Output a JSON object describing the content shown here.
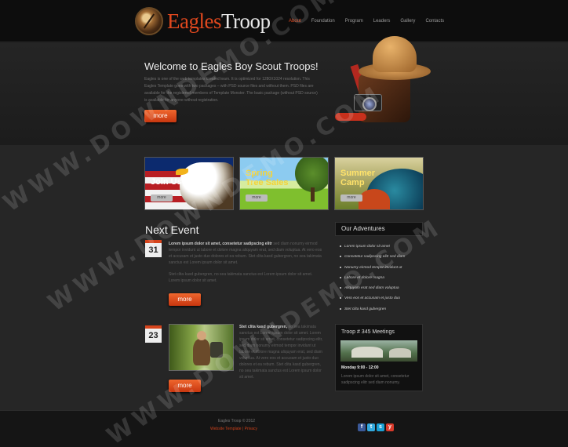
{
  "logo": {
    "word1": "Eagles",
    "word2": "Troop"
  },
  "nav": [
    "About",
    "Foundation",
    "Program",
    "Leaders",
    "Gallery",
    "Contacts"
  ],
  "hero": {
    "title": "Welcome to Eagles Boy Scout Troops!",
    "body": "Eagles is one of the web templates created team. It is optimized for 1280X1024 resolution. This Eagles Template goes with two packages – with PSD source files and without them. PSD files are available for the registered members of Template Monster. The basic package (without PSD source) is available for anyone without registration.",
    "button": "more"
  },
  "banners": [
    {
      "title": "Join Us",
      "button": "more"
    },
    {
      "title": "Spring Tree Sales",
      "button": "more"
    },
    {
      "title": "Summer Camp",
      "button": "more"
    }
  ],
  "next_event": {
    "heading": "Next Event",
    "events": [
      {
        "day": "31",
        "lead": "Lorem ipsum dolor sit amet, consetetur sadipscing elitr",
        "body": "sed diam nonumy eirmod tempor invidunt ut labore et dolore magna aliquyam erat, sed diam voluptua. At vero eos et accusam et justo duo dolores et ea rebum. Stet clita kasd gubergren, no sea takimata sanctus est Lorem ipsum dolor sit amet.",
        "body2": "Stet clita kasd gubergren, no sea takimata sanctus est Lorem ipsum dolor sit amet. Lorem ipsum dolor sit amet.",
        "button": "more"
      },
      {
        "day": "23",
        "lead": "Stet clita kasd gubergren,",
        "body": "no sea takimata sanctus est Lorem ipsum dolor sit amet. Lorem ipsum dolor sit amet, consetetur sadipscing elitr, sed diam nonumy eirmod tempor invidunt ut labore et dolore magna aliquyam erat, sed diam voluptua. At vero eos et accusam et justo duo dolores et ea rebum. Stet clita kasd gubergren, no sea takimata sanctus est Lorem ipsum dolor sit amet.",
        "button": "more"
      }
    ]
  },
  "adventures": {
    "heading": "Our Adventures",
    "items": [
      "Lorem ipsum dolor sit amet",
      "Consetetur sadipscing elitr sed diam",
      "Nonumy eirmod tempor invidunt ut",
      "Labore et dolore magna",
      "Aliquyam erat sed diam voluptua",
      "Vero eos et accusam et justo duo",
      "Stet clita kasd gubergren"
    ]
  },
  "meetings": {
    "heading": "Troop # 345 Meetings",
    "day": "Monday 9:00 - 12:00",
    "text": "Lorem ipsum dolor sit amet, consetetur sadipscing elitr sed diam nonumy."
  },
  "footer": {
    "copyright": "Eagles Troop © 2012",
    "links": "Website Template | Privacy"
  },
  "social": [
    {
      "name": "facebook-icon",
      "glyph": "f",
      "color": "#3b5998"
    },
    {
      "name": "twitter-icon",
      "glyph": "t",
      "color": "#33a9dd"
    },
    {
      "name": "skype-icon",
      "glyph": "s",
      "color": "#1aa1d6"
    },
    {
      "name": "youtube-icon",
      "glyph": "y",
      "color": "#d93a2b"
    }
  ],
  "watermark": "WWW.DOWNDEMO.COM",
  "colors": {
    "accent": "#e0481e",
    "background": "#1f1f1f"
  }
}
